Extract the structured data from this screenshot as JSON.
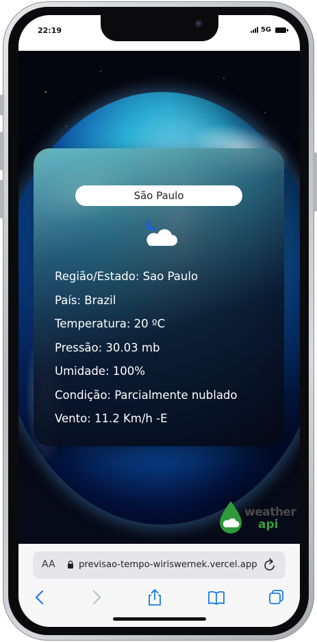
{
  "status_bar": {
    "time": "22:19",
    "network": "5G",
    "icons": [
      "signal-icon",
      "battery-icon"
    ]
  },
  "weather_card": {
    "city_input_value": "São Paulo",
    "condition_icon": "partly-cloudy-night-icon",
    "lines": [
      "Região/Estado: Sao Paulo",
      "País: Brazil",
      "Temperatura: 20 ºC",
      "Pressão: 30.03 mb",
      "Umidade: 100%",
      "Condição: Parcialmente nublado",
      "Vento: 11.2 Km/h -E"
    ]
  },
  "logo": {
    "line1": "weather",
    "line2": "api"
  },
  "browser": {
    "aa_label": "AA",
    "url": "previsao-tempo-wiriswernek.vercel.app",
    "icons": [
      "lock-icon",
      "reload-icon",
      "back-icon",
      "forward-icon",
      "share-icon",
      "bookmarks-icon",
      "tabs-icon"
    ]
  },
  "colors": {
    "accent_blue": "#1a7ae0",
    "logo_green": "#3a9a3a",
    "card_text": "#ffffff"
  }
}
